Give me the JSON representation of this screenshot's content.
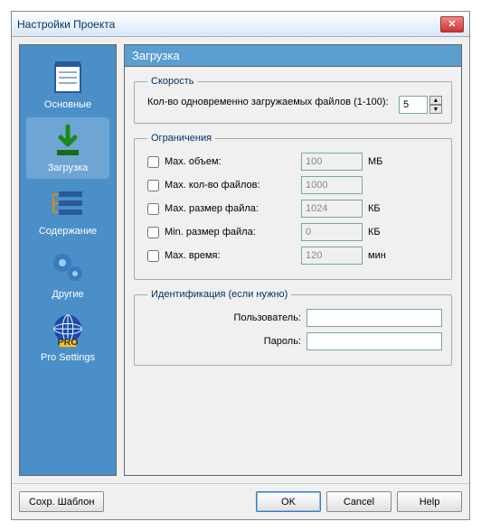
{
  "window": {
    "title": "Настройки Проекта"
  },
  "sidebar": {
    "items": [
      {
        "label": "Основные"
      },
      {
        "label": "Загрузка"
      },
      {
        "label": "Содержание"
      },
      {
        "label": "Другие"
      },
      {
        "label": "Pro Settings"
      }
    ],
    "selected": 1
  },
  "panel": {
    "heading": "Загрузка"
  },
  "speed": {
    "legend": "Скорость",
    "label": "Кол-во одновременно загружаемых файлов (1-100):",
    "value": "5"
  },
  "limits": {
    "legend": "Ограничения",
    "rows": [
      {
        "label": "Max. объем:",
        "value": "100",
        "unit": "МБ"
      },
      {
        "label": "Max. кол-во файлов:",
        "value": "1000",
        "unit": ""
      },
      {
        "label": "Мах. размер файла:",
        "value": "1024",
        "unit": "КБ"
      },
      {
        "label": "Min. размер файла:",
        "value": "0",
        "unit": "КБ"
      },
      {
        "label": "Max. время:",
        "value": "120",
        "unit": "мин"
      }
    ]
  },
  "ident": {
    "legend": "Идентификация (если нужно)",
    "user_label": "Пользователь:",
    "pass_label": "Пароль:",
    "user_value": "",
    "pass_value": ""
  },
  "footer": {
    "save_template": "Сохр. Шаблон",
    "ok": "OK",
    "cancel": "Cancel",
    "help": "Help"
  }
}
